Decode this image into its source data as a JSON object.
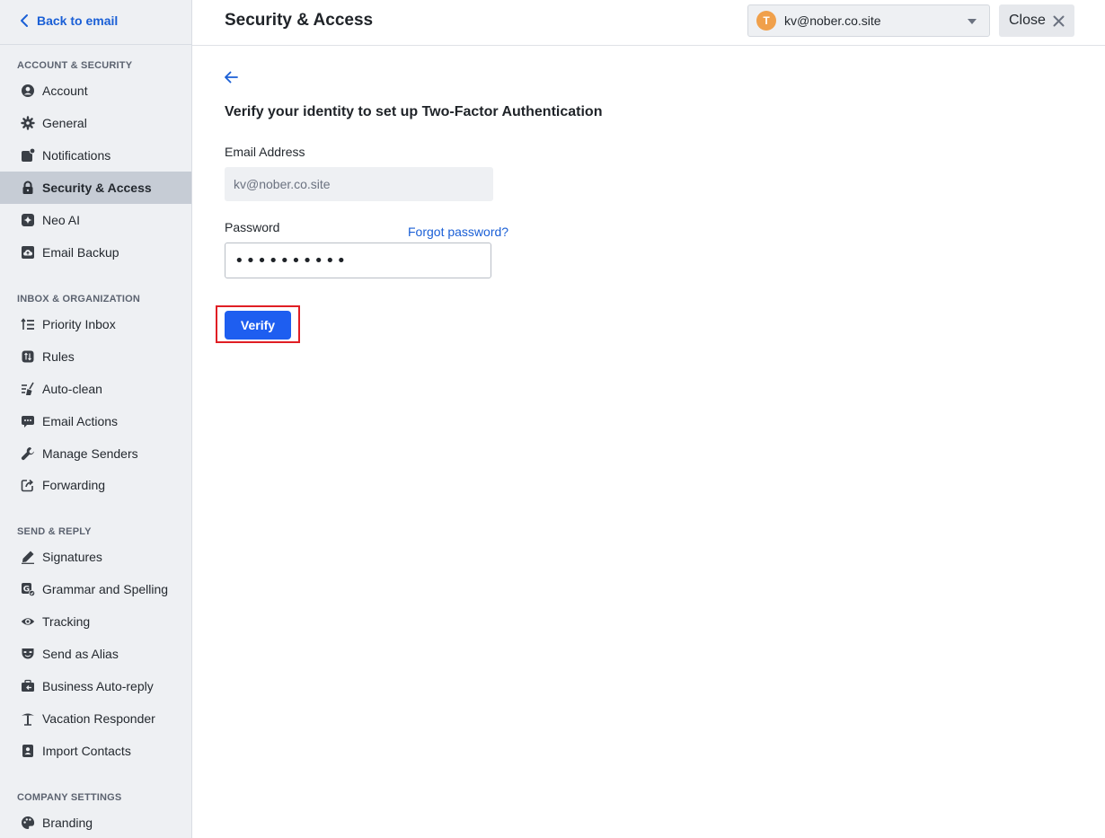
{
  "sidebar": {
    "back_label": "Back to email",
    "sections": {
      "account": "ACCOUNT & SECURITY",
      "inbox": "INBOX & ORGANIZATION",
      "send": "SEND & REPLY",
      "company": "COMPANY SETTINGS"
    },
    "items": [
      {
        "label": "Account",
        "icon": "user-circle-icon"
      },
      {
        "label": "General",
        "icon": "gear-icon"
      },
      {
        "label": "Notifications",
        "icon": "notification-icon"
      },
      {
        "label": "Security & Access",
        "icon": "lock-icon",
        "active": true
      },
      {
        "label": "Neo AI",
        "icon": "sparkle-icon"
      },
      {
        "label": "Email Backup",
        "icon": "cloud-backup-icon"
      },
      {
        "label": "Priority Inbox",
        "icon": "priority-list-icon"
      },
      {
        "label": "Rules",
        "icon": "rules-icon"
      },
      {
        "label": "Auto-clean",
        "icon": "broom-icon"
      },
      {
        "label": "Email Actions",
        "icon": "chat-actions-icon"
      },
      {
        "label": "Manage Senders",
        "icon": "wrench-icon"
      },
      {
        "label": "Forwarding",
        "icon": "forward-icon"
      },
      {
        "label": "Signatures",
        "icon": "pen-icon"
      },
      {
        "label": "Grammar and Spelling",
        "icon": "grammar-check-icon"
      },
      {
        "label": "Tracking",
        "icon": "eye-icon"
      },
      {
        "label": "Send as Alias",
        "icon": "mask-icon"
      },
      {
        "label": "Business Auto-reply",
        "icon": "auto-reply-icon"
      },
      {
        "label": "Vacation Responder",
        "icon": "palm-tree-icon"
      },
      {
        "label": "Import Contacts",
        "icon": "contacts-icon"
      },
      {
        "label": "Branding",
        "icon": "palette-icon"
      }
    ]
  },
  "header": {
    "title": "Security & Access",
    "account": {
      "avatar_letter": "T",
      "email": "kv@nober.co.site"
    },
    "close_label": "Close"
  },
  "main": {
    "heading": "Verify your identity to set up Two-Factor Authentication",
    "email_label": "Email Address",
    "email_value": "kv@nober.co.site",
    "password_label": "Password",
    "password_mask": "••••••••••",
    "forgot_label": "Forgot password?",
    "verify_label": "Verify"
  },
  "colors": {
    "accent": "#1e5ef0",
    "link": "#1a5fd6",
    "highlight": "#e01e24",
    "avatar": "#f0a04b",
    "sidebar_bg": "#eef0f3",
    "active_bg": "#c6ccd5"
  }
}
